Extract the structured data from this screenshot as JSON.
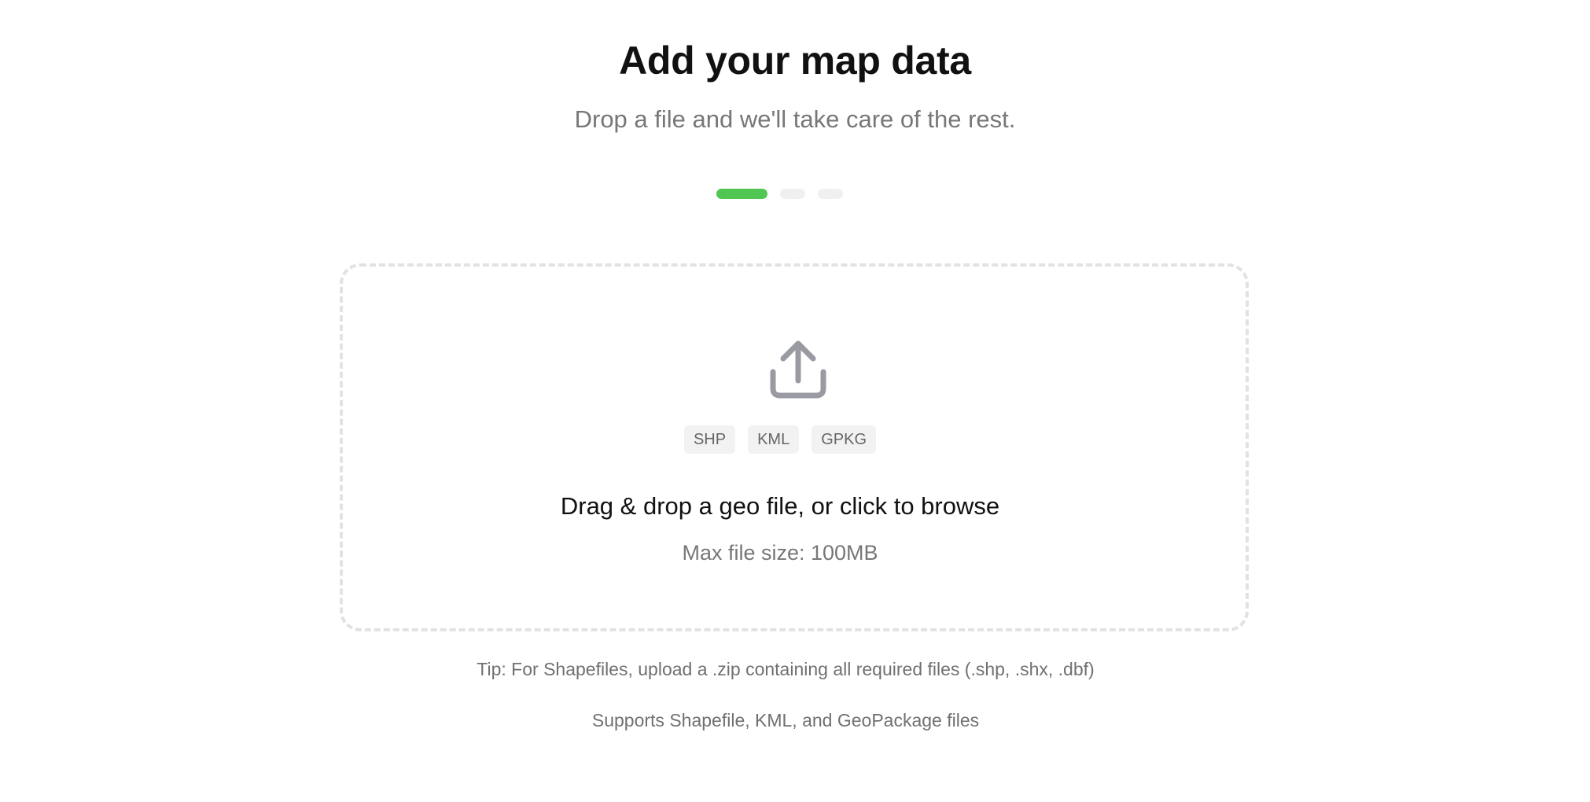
{
  "header": {
    "title": "Add your map data",
    "subtitle": "Drop a file and we'll take care of the rest."
  },
  "steps": {
    "total": 3,
    "current": 1,
    "active_color": "#52c652",
    "inactive_color": "#f0f0f0"
  },
  "dropzone": {
    "icon": "upload-icon",
    "formats": [
      "SHP",
      "KML",
      "GPKG"
    ],
    "prompt": "Drag & drop a geo file, or click to browse",
    "max_size": "Max file size: 100MB"
  },
  "footer": {
    "tip": "Tip: For Shapefiles, upload a .zip containing all required files (.shp, .shx, .dbf)",
    "supports": "Supports Shapefile, KML, and GeoPackage files"
  }
}
